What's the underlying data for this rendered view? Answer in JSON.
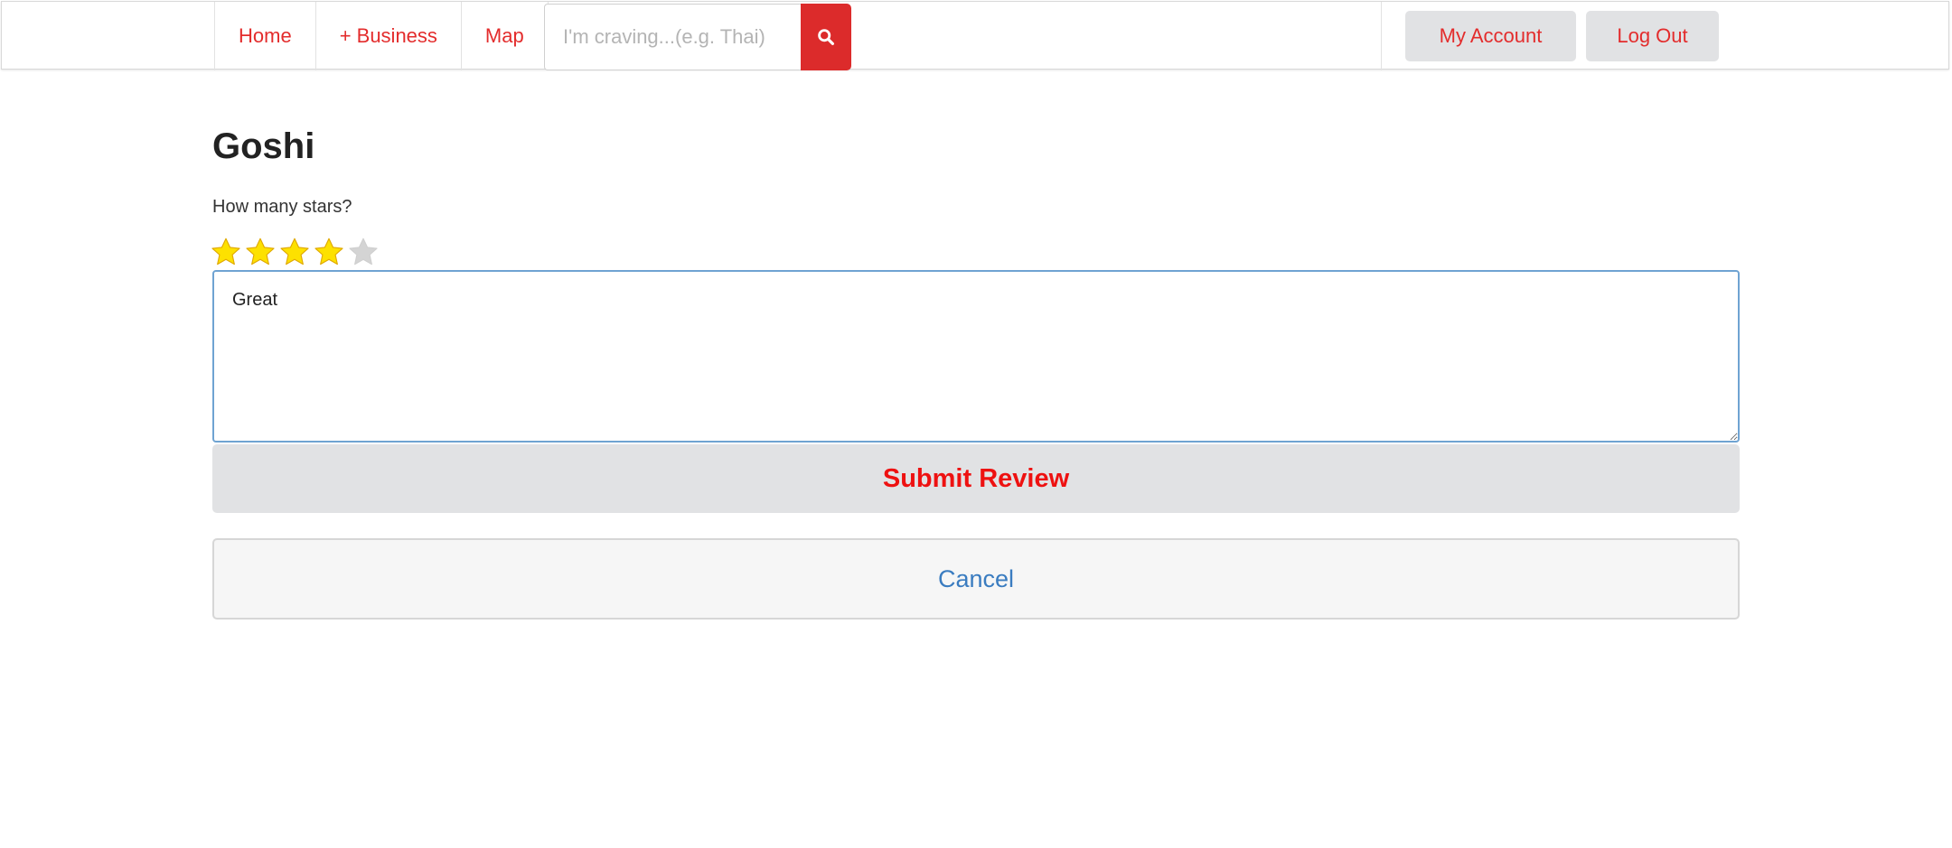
{
  "nav": {
    "links": [
      {
        "label": "Home"
      },
      {
        "label": "+ Business"
      },
      {
        "label": "Map"
      }
    ],
    "search": {
      "placeholder": "I'm craving...(e.g. Thai)",
      "value": "",
      "icon": "search-icon"
    },
    "account_label": "My Account",
    "logout_label": "Log Out"
  },
  "main": {
    "title": "Goshi",
    "stars_label": "How many stars?",
    "rating": {
      "value": 4,
      "max": 5
    },
    "review_text": "Great",
    "submit_label": "Submit Review",
    "cancel_label": "Cancel"
  },
  "colors": {
    "brand_red": "#e32c2c",
    "submit_text": "#ee1111",
    "cancel_text": "#3a7cc0",
    "star_filled": "#fde100",
    "star_empty": "#d4d4d4",
    "button_bg": "#e1e2e4"
  }
}
